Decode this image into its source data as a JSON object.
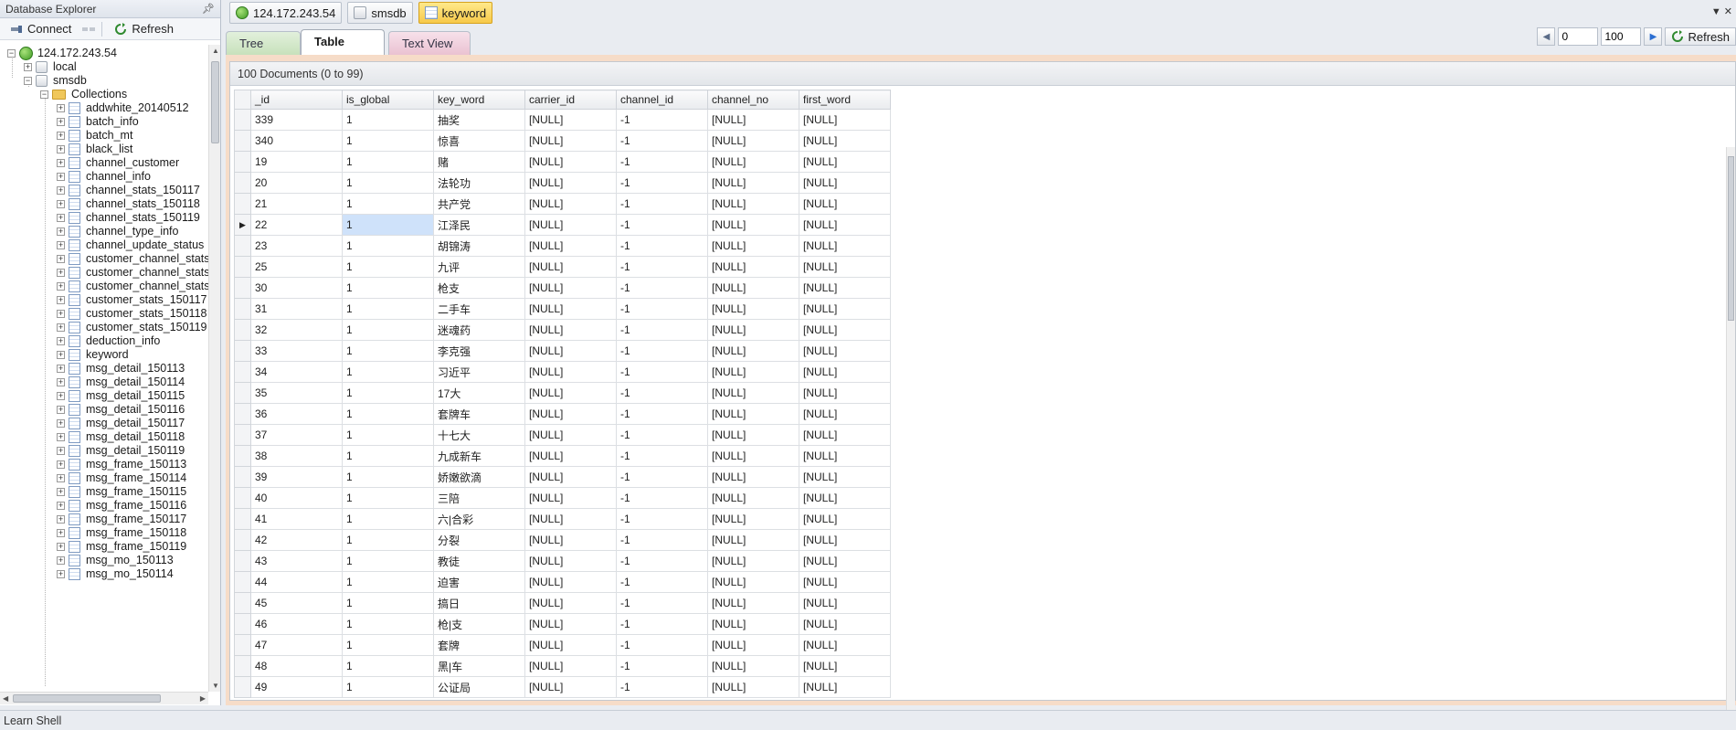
{
  "explorer": {
    "title": "Database Explorer",
    "pin_icon": "pin-icon",
    "toolbar": {
      "connect_label": "Connect",
      "refresh_label": "Refresh"
    },
    "tree": {
      "server": "124.172.243.54",
      "databases": [
        "local",
        "smsdb"
      ],
      "folder": "Collections",
      "collections": [
        "addwhite_20140512",
        "batch_info",
        "batch_mt",
        "black_list",
        "channel_customer",
        "channel_info",
        "channel_stats_150117",
        "channel_stats_150118",
        "channel_stats_150119",
        "channel_type_info",
        "channel_update_status",
        "customer_channel_stats",
        "customer_channel_stats",
        "customer_channel_stats",
        "customer_stats_150117",
        "customer_stats_150118",
        "customer_stats_150119",
        "deduction_info",
        "keyword",
        "msg_detail_150113",
        "msg_detail_150114",
        "msg_detail_150115",
        "msg_detail_150116",
        "msg_detail_150117",
        "msg_detail_150118",
        "msg_detail_150119",
        "msg_frame_150113",
        "msg_frame_150114",
        "msg_frame_150115",
        "msg_frame_150116",
        "msg_frame_150117",
        "msg_frame_150118",
        "msg_frame_150119",
        "msg_mo_150113",
        "msg_mo_150114"
      ]
    }
  },
  "breadcrumbs": [
    "124.172.243.54",
    "smsdb",
    "keyword"
  ],
  "view_tabs": {
    "tree": "Tree View",
    "table": "Table View",
    "text": "Text View"
  },
  "pager": {
    "skip": "0",
    "limit": "100",
    "refresh_label": "Refresh"
  },
  "result": {
    "summary": "100 Documents (0 to 99)",
    "columns": [
      "_id",
      "is_global",
      "key_word",
      "carrier_id",
      "channel_id",
      "channel_no",
      "first_word"
    ],
    "selected_row": 5,
    "selected_col": 1,
    "rows": [
      [
        "339",
        "1",
        "抽奖",
        "[NULL]",
        "-1",
        "[NULL]",
        "[NULL]"
      ],
      [
        "340",
        "1",
        "惊喜",
        "[NULL]",
        "-1",
        "[NULL]",
        "[NULL]"
      ],
      [
        "19",
        "1",
        "赌",
        "[NULL]",
        "-1",
        "[NULL]",
        "[NULL]"
      ],
      [
        "20",
        "1",
        "法轮功",
        "[NULL]",
        "-1",
        "[NULL]",
        "[NULL]"
      ],
      [
        "21",
        "1",
        "共产党",
        "[NULL]",
        "-1",
        "[NULL]",
        "[NULL]"
      ],
      [
        "22",
        "1",
        "江泽民",
        "[NULL]",
        "-1",
        "[NULL]",
        "[NULL]"
      ],
      [
        "23",
        "1",
        "胡锦涛",
        "[NULL]",
        "-1",
        "[NULL]",
        "[NULL]"
      ],
      [
        "25",
        "1",
        "九评",
        "[NULL]",
        "-1",
        "[NULL]",
        "[NULL]"
      ],
      [
        "30",
        "1",
        "枪支",
        "[NULL]",
        "-1",
        "[NULL]",
        "[NULL]"
      ],
      [
        "31",
        "1",
        "二手车",
        "[NULL]",
        "-1",
        "[NULL]",
        "[NULL]"
      ],
      [
        "32",
        "1",
        "迷魂药",
        "[NULL]",
        "-1",
        "[NULL]",
        "[NULL]"
      ],
      [
        "33",
        "1",
        "李克强",
        "[NULL]",
        "-1",
        "[NULL]",
        "[NULL]"
      ],
      [
        "34",
        "1",
        "习近平",
        "[NULL]",
        "-1",
        "[NULL]",
        "[NULL]"
      ],
      [
        "35",
        "1",
        "17大",
        "[NULL]",
        "-1",
        "[NULL]",
        "[NULL]"
      ],
      [
        "36",
        "1",
        "套牌车",
        "[NULL]",
        "-1",
        "[NULL]",
        "[NULL]"
      ],
      [
        "37",
        "1",
        "十七大",
        "[NULL]",
        "-1",
        "[NULL]",
        "[NULL]"
      ],
      [
        "38",
        "1",
        "九成新车",
        "[NULL]",
        "-1",
        "[NULL]",
        "[NULL]"
      ],
      [
        "39",
        "1",
        "娇嫩欲滴",
        "[NULL]",
        "-1",
        "[NULL]",
        "[NULL]"
      ],
      [
        "40",
        "1",
        "三陪",
        "[NULL]",
        "-1",
        "[NULL]",
        "[NULL]"
      ],
      [
        "41",
        "1",
        "六|合彩",
        "[NULL]",
        "-1",
        "[NULL]",
        "[NULL]"
      ],
      [
        "42",
        "1",
        "分裂",
        "[NULL]",
        "-1",
        "[NULL]",
        "[NULL]"
      ],
      [
        "43",
        "1",
        "教徒",
        "[NULL]",
        "-1",
        "[NULL]",
        "[NULL]"
      ],
      [
        "44",
        "1",
        "迫害",
        "[NULL]",
        "-1",
        "[NULL]",
        "[NULL]"
      ],
      [
        "45",
        "1",
        "搞日",
        "[NULL]",
        "-1",
        "[NULL]",
        "[NULL]"
      ],
      [
        "46",
        "1",
        "枪|支",
        "[NULL]",
        "-1",
        "[NULL]",
        "[NULL]"
      ],
      [
        "47",
        "1",
        "套牌",
        "[NULL]",
        "-1",
        "[NULL]",
        "[NULL]"
      ],
      [
        "48",
        "1",
        "黑|车",
        "[NULL]",
        "-1",
        "[NULL]",
        "[NULL]"
      ],
      [
        "49",
        "1",
        "公证局",
        "[NULL]",
        "-1",
        "[NULL]",
        "[NULL]"
      ]
    ]
  },
  "statusbar": {
    "text": "Learn Shell"
  },
  "colors": {
    "accent_tab": "#f7c94a",
    "selection": "#cfe2fa",
    "result_border": "#f6dcc8"
  }
}
